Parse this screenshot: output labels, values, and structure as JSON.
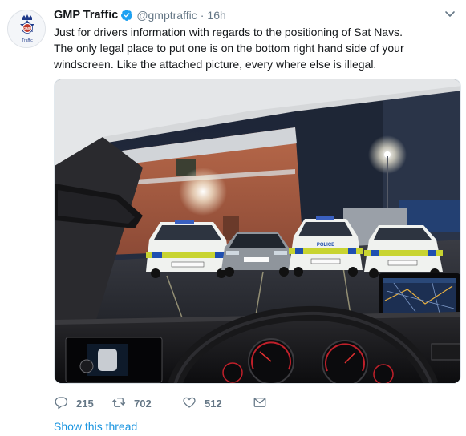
{
  "tweet": {
    "display_name": "GMP Traffic",
    "handle": "@gmptraffic",
    "separator": "·",
    "time": "16h",
    "text_lines": [
      "Just for drivers information with regards to the positioning of Sat Navs.",
      "The only legal place to put one is on the bottom right hand side of your",
      "windscreen.  Like the attached picture, every where else is illegal."
    ]
  },
  "avatar": {
    "badge_text": "GMP",
    "caption": "Traffic"
  },
  "actions": {
    "reply_count": "215",
    "retweet_count": "702",
    "like_count": "512"
  },
  "show_thread_label": "Show this thread",
  "photo": {
    "police_plate_text": "POLICE"
  },
  "colors": {
    "accent": "#1b95e0",
    "text": "#14171a",
    "muted": "#657786",
    "verified": "#1da1f2"
  },
  "icons": {
    "verified": "verified-badge-icon",
    "more": "chevron-down-icon",
    "reply": "reply-icon",
    "retweet": "retweet-icon",
    "like": "heart-icon",
    "dm": "envelope-icon"
  }
}
